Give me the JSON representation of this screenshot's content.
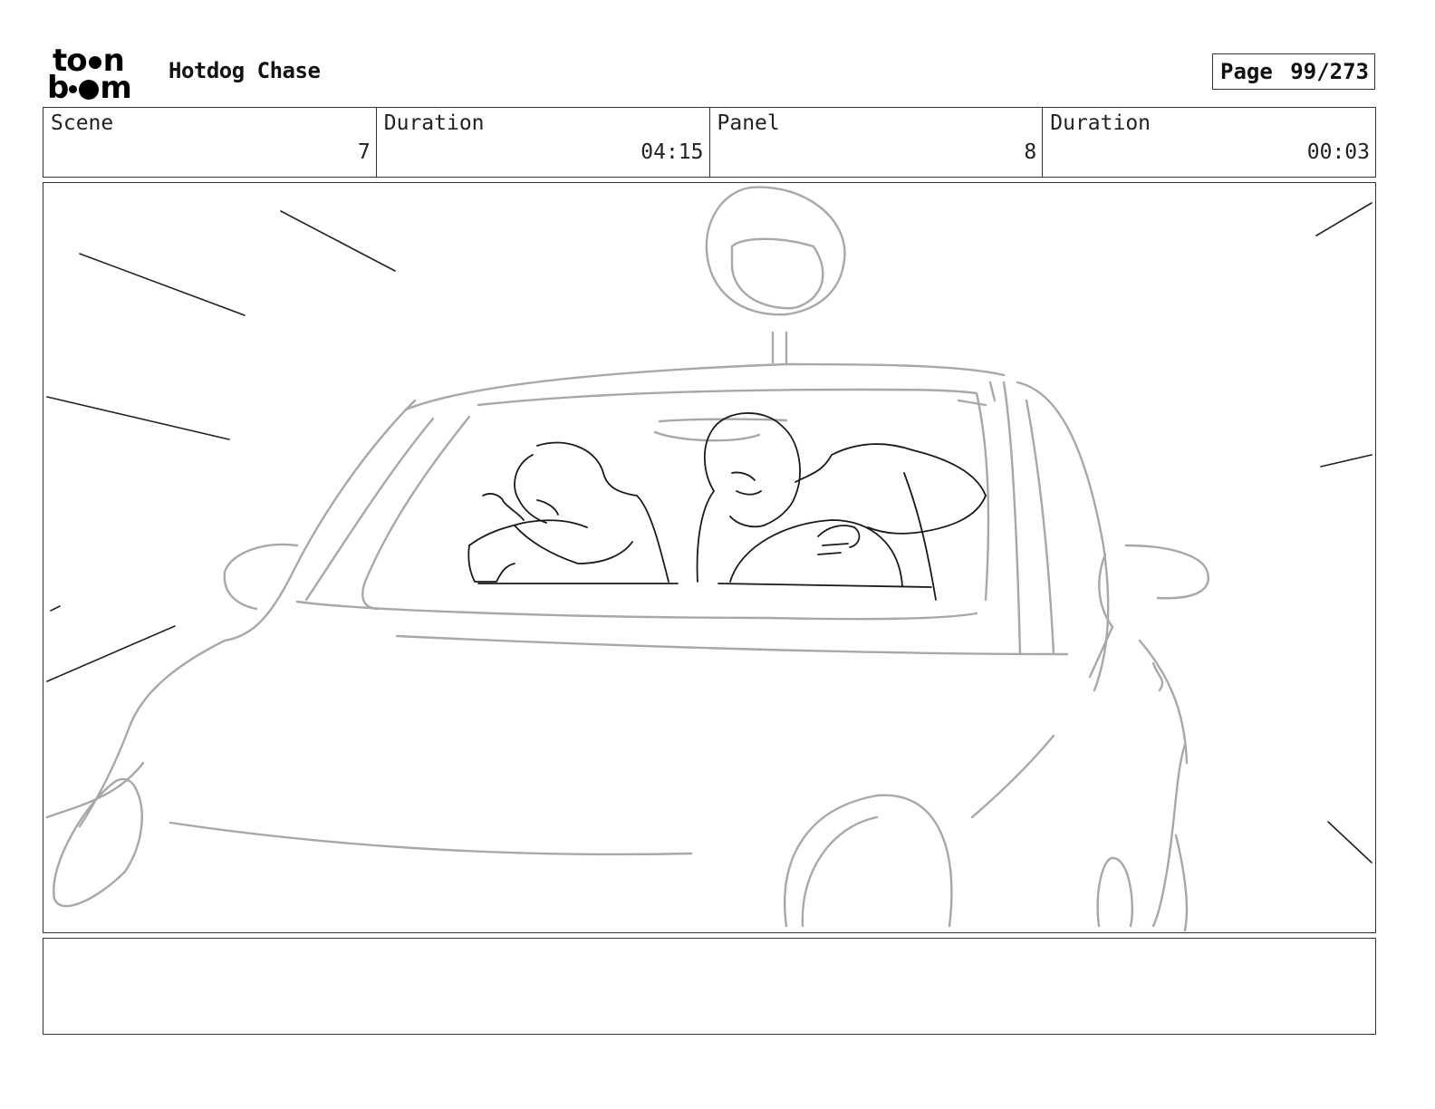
{
  "header": {
    "logo_top": "to",
    "logo_top_end": "n",
    "logo_bottom_start": "b",
    "logo_bottom_end": "m",
    "project_title": "Hotdog Chase",
    "page_label": "Page",
    "page_number": "99/273"
  },
  "info": {
    "scene_label": "Scene",
    "scene_value": "7",
    "scene_duration_label": "Duration",
    "scene_duration_value": "04:15",
    "panel_label": "Panel",
    "panel_value": "8",
    "panel_duration_label": "Duration",
    "panel_duration_value": "00:03"
  },
  "panel": {
    "sketch": "car-interior-drawing",
    "line_color": "#a8a8a8",
    "ink_color": "#1a1a1a"
  },
  "notes": {
    "text": ""
  }
}
